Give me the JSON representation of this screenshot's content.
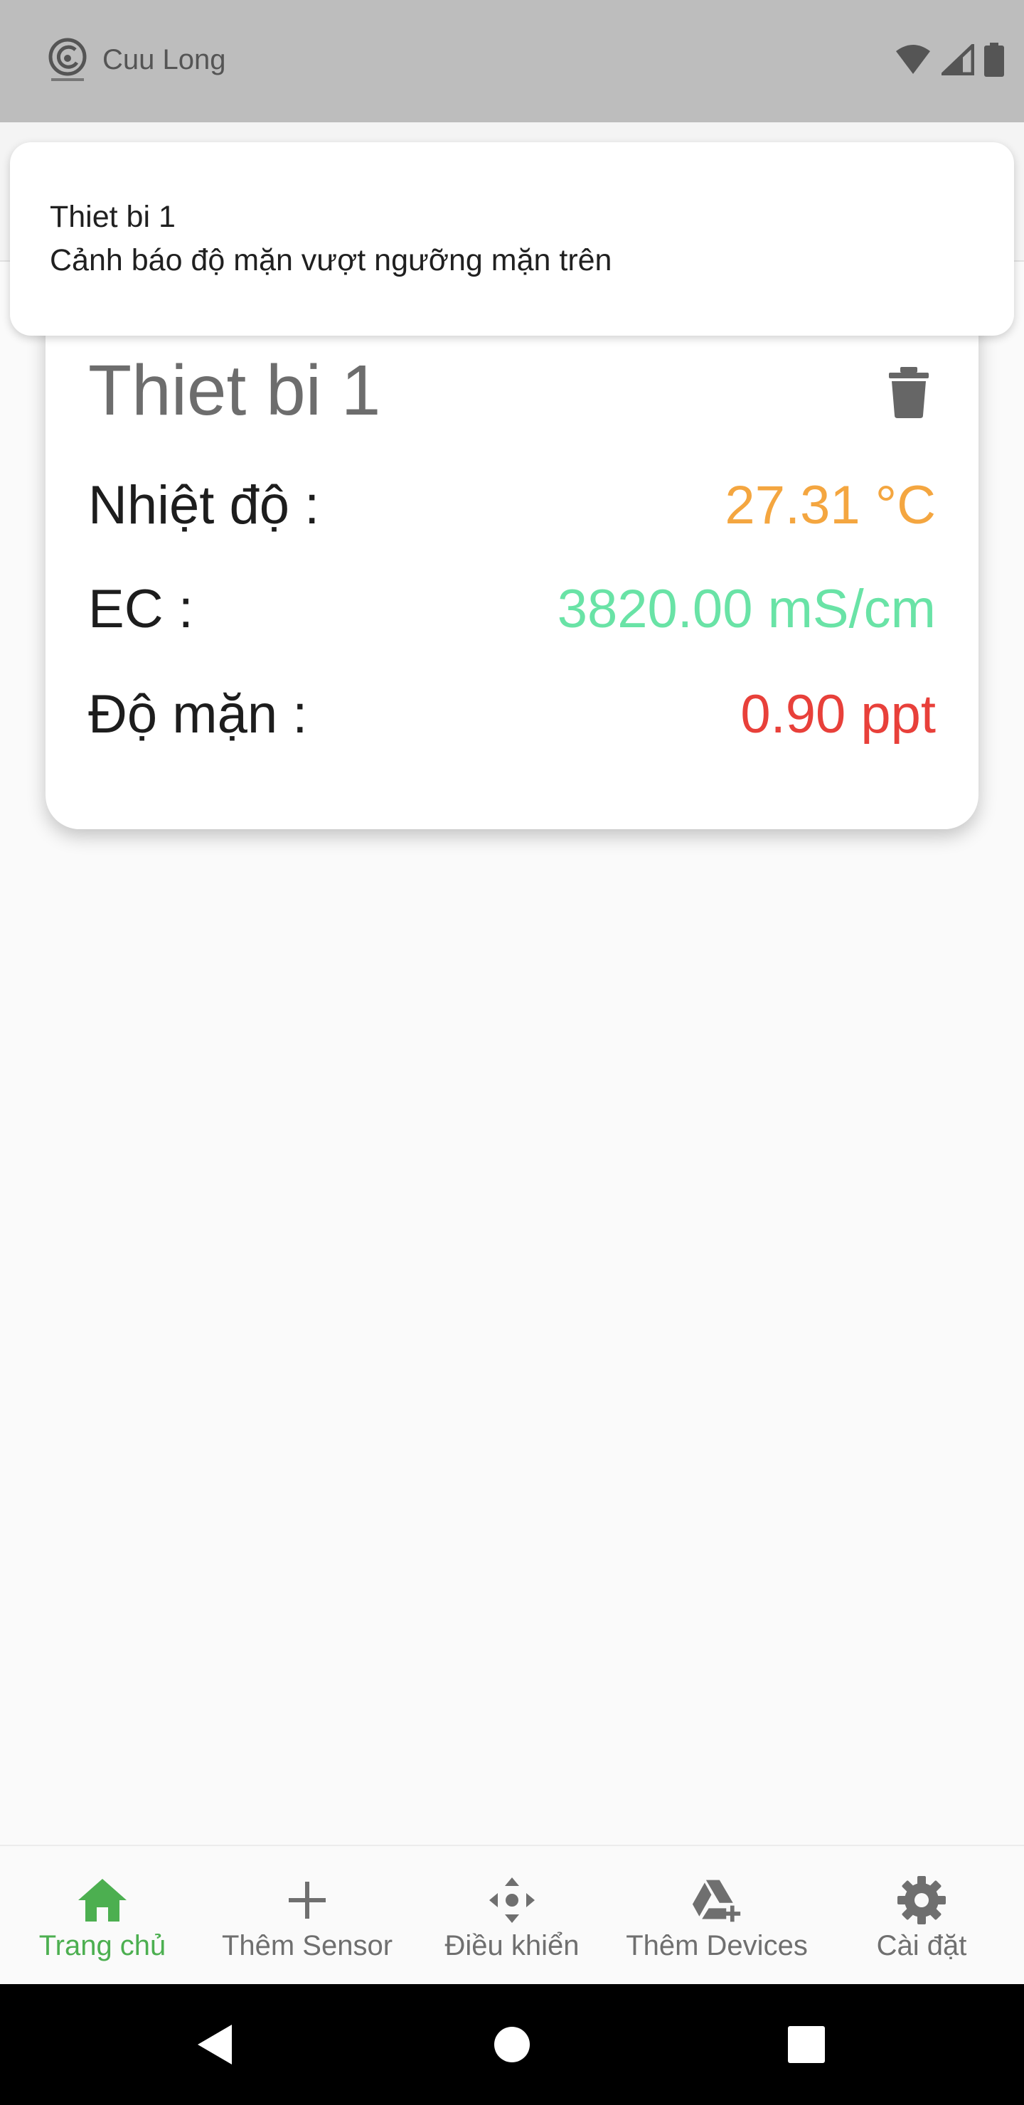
{
  "status_bar": {
    "carrier": "Cuu Long"
  },
  "notification": {
    "title": "Thiet bi 1",
    "message": "Cảnh báo độ mặn vượt ngưỡng mặn trên"
  },
  "device_card": {
    "name": "Thiet bi 1",
    "temperature": {
      "label": "Nhiệt độ :",
      "value": "27.31 °C",
      "color": "#f4a640"
    },
    "ec": {
      "label": "EC :",
      "value": "3820.00 mS/cm",
      "color": "#69e3a6"
    },
    "salinity": {
      "label": "Độ mặn :",
      "value": "0.90 ppt",
      "color": "#e8403a"
    }
  },
  "bottom_nav": {
    "active_color": "#4caf50",
    "items": [
      {
        "label": "Trang chủ",
        "icon": "home-icon"
      },
      {
        "label": "Thêm Sensor",
        "icon": "plus-icon"
      },
      {
        "label": "Điều khiển",
        "icon": "control-dpad-icon"
      },
      {
        "label": "Thêm Devices",
        "icon": "add-device-icon"
      },
      {
        "label": "Cài đặt",
        "icon": "gear-icon"
      }
    ]
  }
}
